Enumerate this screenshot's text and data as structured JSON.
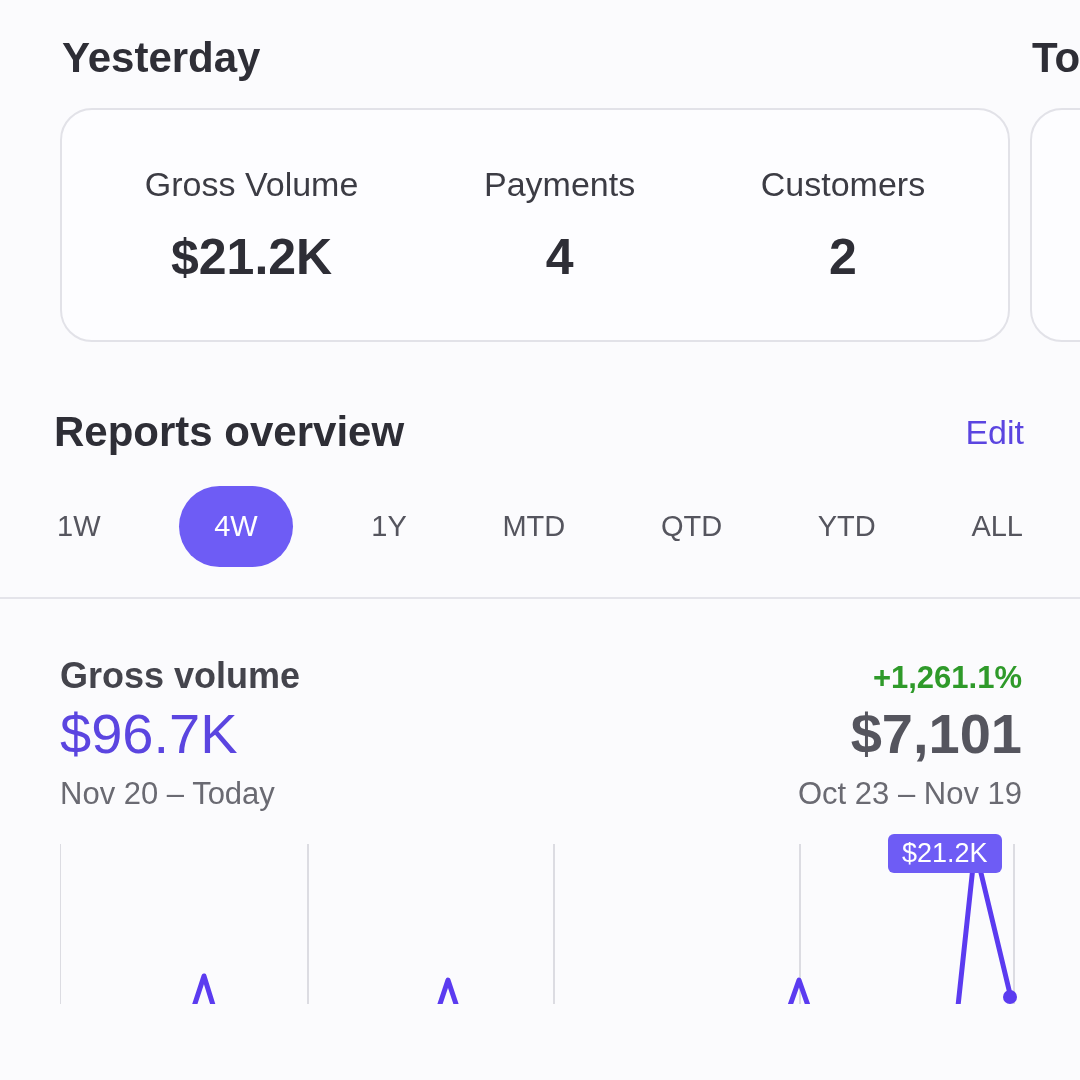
{
  "summaries": [
    {
      "title": "Yesterday",
      "stats": [
        {
          "label": "Gross Volume",
          "value": "$21.2K"
        },
        {
          "label": "Payments",
          "value": "4"
        },
        {
          "label": "Customers",
          "value": "2"
        }
      ]
    },
    {
      "title": "To"
    }
  ],
  "reports": {
    "title": "Reports overview",
    "edit": "Edit",
    "periods": [
      {
        "label": "1W",
        "selected": false
      },
      {
        "label": "4W",
        "selected": true
      },
      {
        "label": "1Y",
        "selected": false
      },
      {
        "label": "MTD",
        "selected": false
      },
      {
        "label": "QTD",
        "selected": false
      },
      {
        "label": "YTD",
        "selected": false
      },
      {
        "label": "ALL",
        "selected": false
      }
    ]
  },
  "metric": {
    "title": "Gross volume",
    "change": "+1,261.1%",
    "current": "$96.7K",
    "previous": "$7,101",
    "current_range": "Nov 20 – Today",
    "previous_range": "Oct 23 – Nov 19",
    "tooltip": "$21.2K"
  }
}
